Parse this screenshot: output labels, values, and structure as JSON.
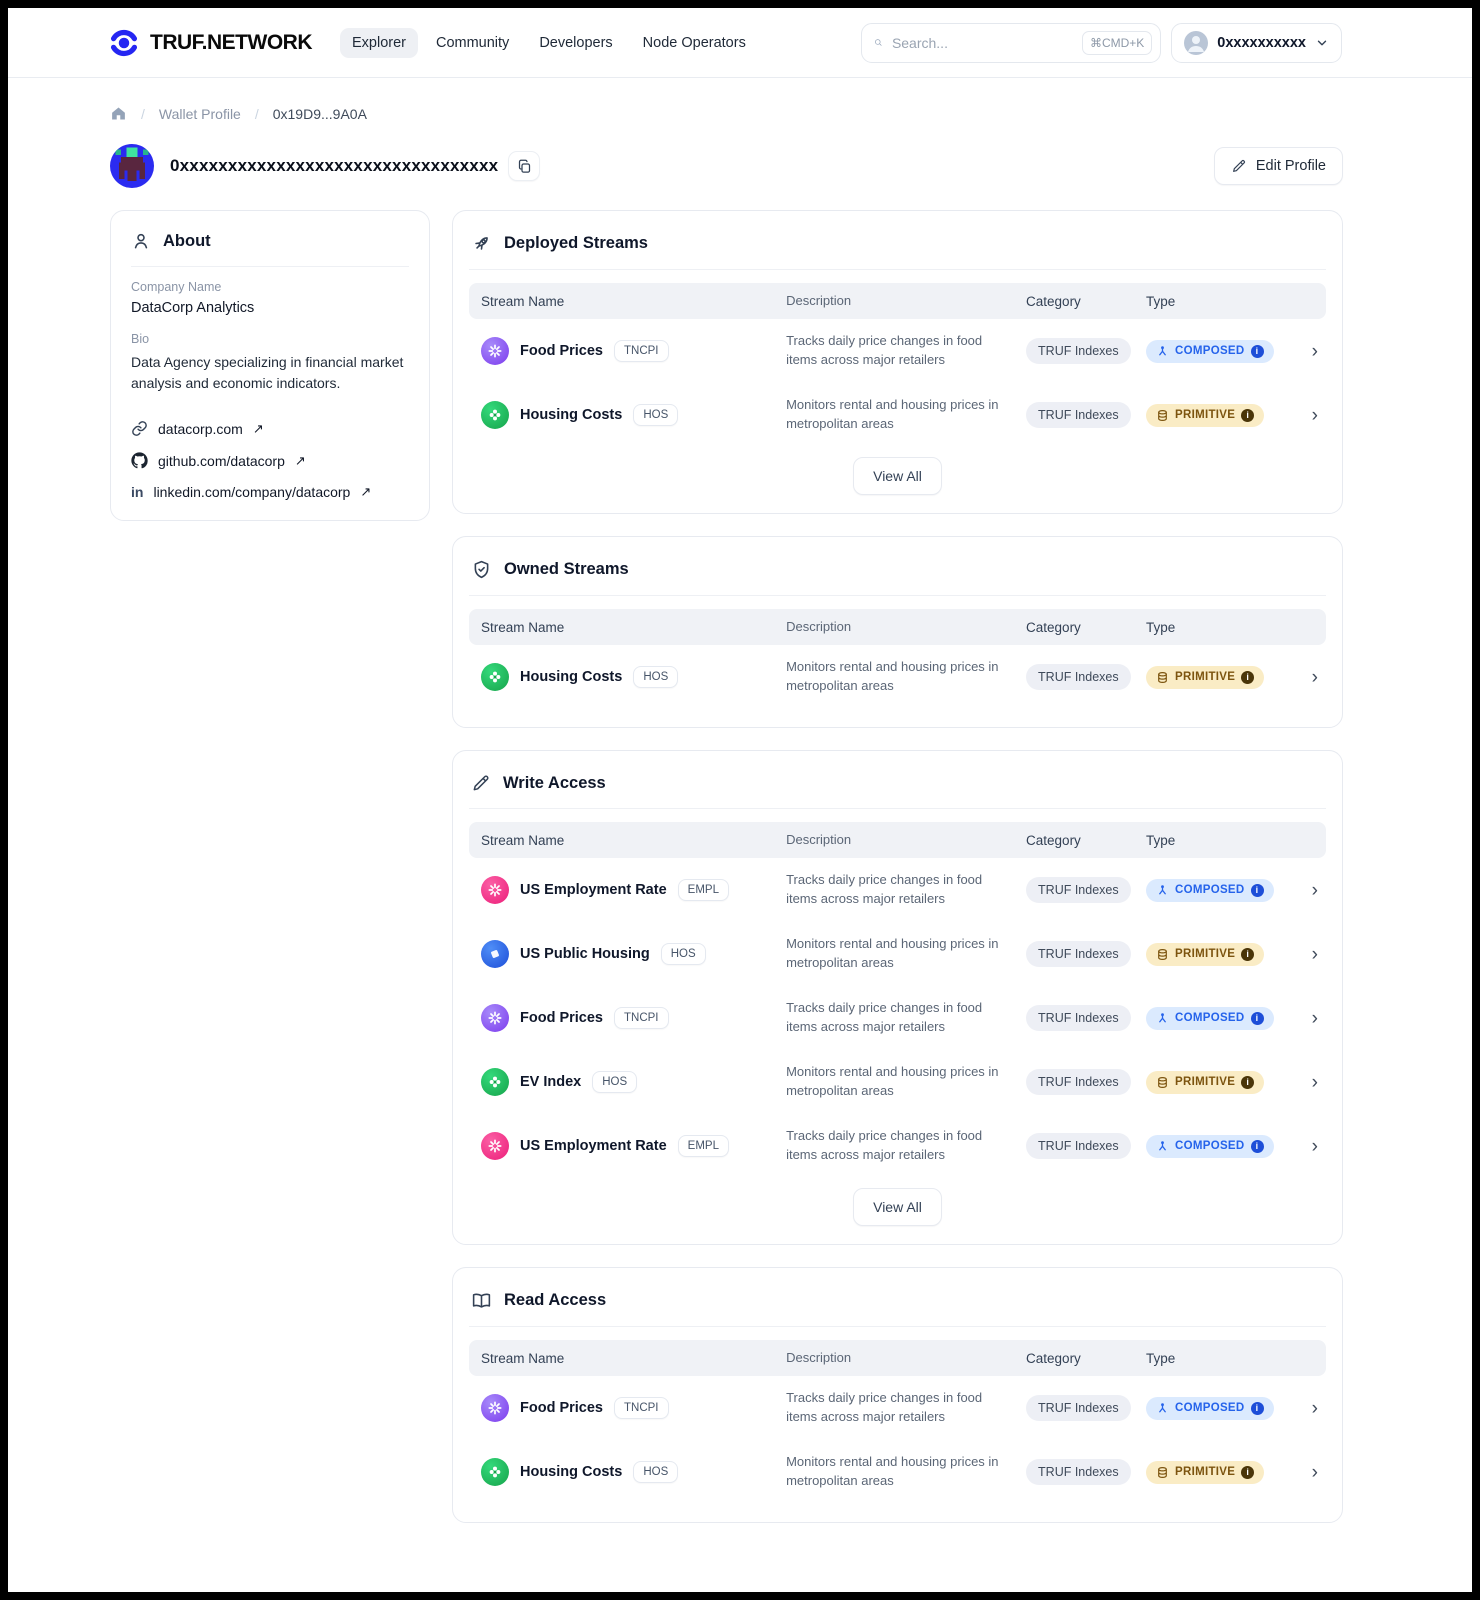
{
  "header": {
    "brand": "TRUF.NETWORK",
    "brand_color": "#2526f2",
    "nav": [
      {
        "label": "Explorer",
        "active": true
      },
      {
        "label": "Community",
        "active": false
      },
      {
        "label": "Developers",
        "active": false
      },
      {
        "label": "Node Operators",
        "active": false
      }
    ],
    "search": {
      "placeholder": "Search...",
      "shortcut": "⌘CMD+K"
    },
    "account": {
      "label": "0xxxxxxxxxx"
    }
  },
  "breadcrumb": {
    "parent": "Wallet Profile",
    "current": "0x19D9...9A0A"
  },
  "profile": {
    "address": "0xxxxxxxxxxxxxxxxxxxxxxxxxxxxxxxxx",
    "edit_button": "Edit Profile"
  },
  "about": {
    "title": "About",
    "company_label": "Company Name",
    "company": "DataCorp Analytics",
    "bio_label": "Bio",
    "bio": "Data Agency specializing in financial market analysis and economic indicators.",
    "links": [
      {
        "icon": "link-icon",
        "label": "datacorp.com"
      },
      {
        "icon": "github-icon",
        "label": "github.com/datacorp"
      },
      {
        "icon": "linkedin-icon",
        "label": "linkedin.com/company/datacorp"
      }
    ],
    "external_arrow": "↗"
  },
  "table": {
    "columns": [
      "Stream Name",
      "Description",
      "Category",
      "Type"
    ]
  },
  "view_all_label": "View All",
  "type_colors": {
    "composed": {
      "bg": "#dbeafe",
      "text": "#2563eb"
    },
    "primitive": {
      "bg": "#faecc5",
      "text": "#7c540f"
    }
  },
  "sections": [
    {
      "id": "deployed",
      "title": "Deployed Streams",
      "icon": "rocket-icon",
      "view_all": true,
      "rows": [
        {
          "name": "Food Prices",
          "ticker": "TNCPI",
          "icon": {
            "variant": "flower",
            "from": "#a78bfa",
            "to": "#7c3aed"
          },
          "description": "Tracks daily price changes in food items across major retailers",
          "category": "TRUF Indexes",
          "type": "COMPOSED"
        },
        {
          "name": "Housing Costs",
          "ticker": "HOS",
          "icon": {
            "variant": "clover",
            "from": "#34d97b",
            "to": "#16a34a"
          },
          "description": "Monitors rental and housing prices in metropolitan areas",
          "category": "TRUF Indexes",
          "type": "PRIMITIVE"
        }
      ]
    },
    {
      "id": "owned",
      "title": "Owned Streams",
      "icon": "shield-check-icon",
      "view_all": false,
      "rows": [
        {
          "name": "Housing Costs",
          "ticker": "HOS",
          "icon": {
            "variant": "clover",
            "from": "#34d97b",
            "to": "#16a34a"
          },
          "description": "Monitors rental and housing prices in metropolitan areas",
          "category": "TRUF Indexes",
          "type": "PRIMITIVE"
        }
      ]
    },
    {
      "id": "write",
      "title": "Write Access",
      "icon": "pencil-icon",
      "view_all": true,
      "rows": [
        {
          "name": "US Employment Rate",
          "ticker": "EMPL",
          "icon": {
            "variant": "flower",
            "from": "#fb5fa5",
            "to": "#ec1e79"
          },
          "description": "Tracks daily price changes in food items across major retailers",
          "category": "TRUF Indexes",
          "type": "COMPOSED"
        },
        {
          "name": "US Public Housing",
          "ticker": "HOS",
          "icon": {
            "variant": "tile",
            "from": "#4f8ef7",
            "to": "#1d4ed8"
          },
          "description": "Monitors rental and housing prices in metropolitan areas",
          "category": "TRUF Indexes",
          "type": "PRIMITIVE"
        },
        {
          "name": "Food Prices",
          "ticker": "TNCPI",
          "icon": {
            "variant": "flower",
            "from": "#a78bfa",
            "to": "#7c3aed"
          },
          "description": "Tracks daily price changes in food items across major retailers",
          "category": "TRUF Indexes",
          "type": "COMPOSED"
        },
        {
          "name": "EV Index",
          "ticker": "HOS",
          "icon": {
            "variant": "clover",
            "from": "#34d97b",
            "to": "#16a34a"
          },
          "description": "Monitors rental and housing prices in metropolitan areas",
          "category": "TRUF Indexes",
          "type": "PRIMITIVE"
        },
        {
          "name": "US Employment Rate",
          "ticker": "EMPL",
          "icon": {
            "variant": "flower",
            "from": "#fb5fa5",
            "to": "#ec1e79"
          },
          "description": "Tracks daily price changes in food items across major retailers",
          "category": "TRUF Indexes",
          "type": "COMPOSED"
        }
      ]
    },
    {
      "id": "read",
      "title": "Read Access",
      "icon": "book-open-icon",
      "view_all": false,
      "rows": [
        {
          "name": "Food Prices",
          "ticker": "TNCPI",
          "icon": {
            "variant": "flower",
            "from": "#a78bfa",
            "to": "#7c3aed"
          },
          "description": "Tracks daily price changes in food items across major retailers",
          "category": "TRUF Indexes",
          "type": "COMPOSED"
        },
        {
          "name": "Housing Costs",
          "ticker": "HOS",
          "icon": {
            "variant": "clover",
            "from": "#34d97b",
            "to": "#16a34a"
          },
          "description": "Monitors rental and housing prices in metropolitan areas",
          "category": "TRUF Indexes",
          "type": "PRIMITIVE"
        }
      ]
    }
  ]
}
